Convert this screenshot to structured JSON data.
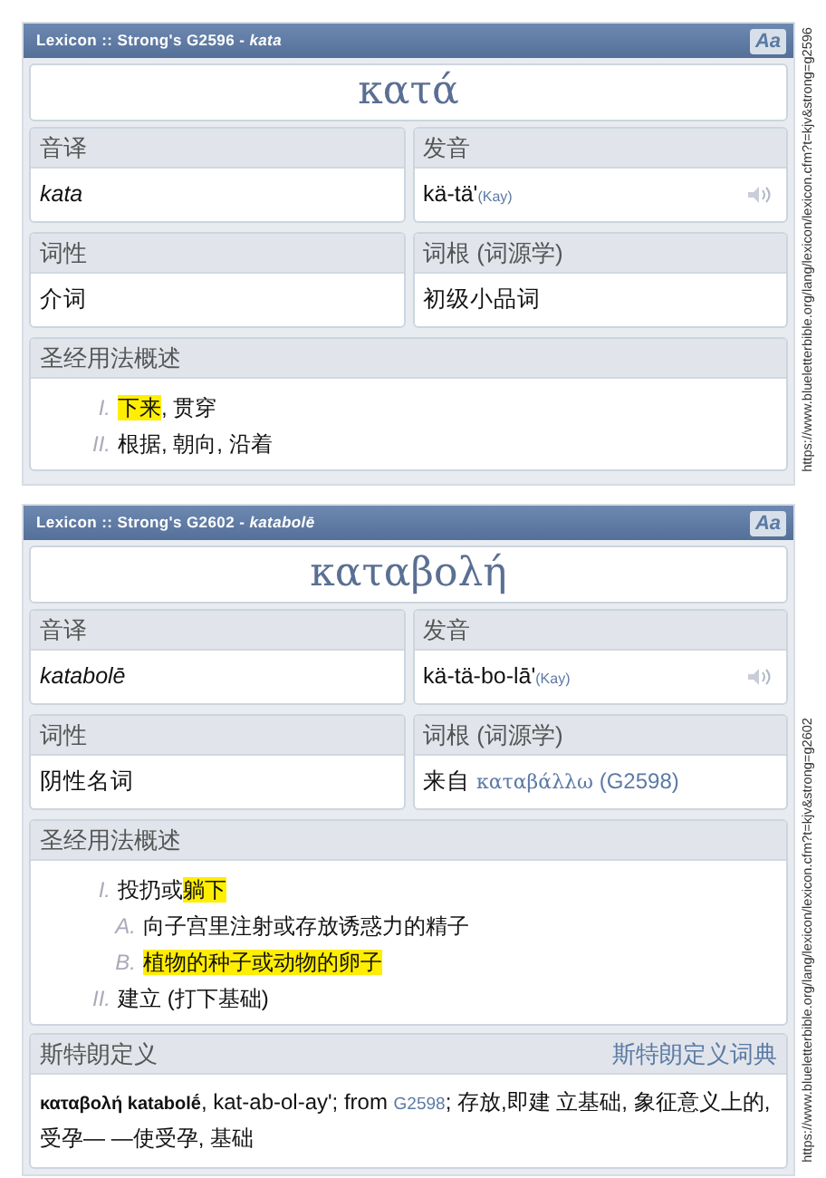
{
  "entries": [
    {
      "title": "Lexicon :: Strong's G2596 - *kata*",
      "font_button": "Aa",
      "word": "κατά",
      "url": "https://www.blueletterbible.org/lang/lexicon/lexicon.cfm?t=kjv&strong=g2596",
      "fields": [
        {
          "label": "音译",
          "kind": "italic",
          "segments": [
            {
              "kind": "text",
              "text": "kata"
            }
          ]
        },
        {
          "label": "发音",
          "kind": "audio",
          "segments": [
            {
              "kind": "text",
              "text": "kä-tä'"
            },
            {
              "kind": "note",
              "text": "(Kay)"
            }
          ]
        },
        {
          "label": "词性",
          "kind": "plain",
          "segments": [
            {
              "kind": "text",
              "text": "介词"
            }
          ]
        },
        {
          "label": "词根 (词源学)",
          "kind": "plain",
          "segments": [
            {
              "kind": "text",
              "text": "初级小品词"
            }
          ]
        }
      ],
      "usage": {
        "label": "圣经用法概述",
        "items": [
          {
            "marker": "I.",
            "segments": [
              {
                "text": "下来",
                "highlighted": true
              },
              {
                "text": ", 贯穿",
                "highlighted": false
              }
            ]
          },
          {
            "marker": "II.",
            "segments": [
              {
                "text": "根据, 朝向, 沿着",
                "highlighted": false
              }
            ]
          }
        ]
      }
    },
    {
      "title": "Lexicon :: Strong's G2602 - *katabolē*",
      "font_button": "Aa",
      "word": "καταβολή",
      "url": "https://www.blueletterbible.org/lang/lexicon/lexicon.cfm?t=kjv&strong=g2602",
      "fields": [
        {
          "label": "音译",
          "kind": "italic",
          "segments": [
            {
              "kind": "text",
              "text": "katabolē"
            }
          ]
        },
        {
          "label": "发音",
          "kind": "audio",
          "segments": [
            {
              "kind": "text",
              "text": "kä-tä-bo-lā'"
            },
            {
              "kind": "note",
              "text": "(Kay)"
            }
          ]
        },
        {
          "label": "词性",
          "kind": "plain",
          "segments": [
            {
              "kind": "text",
              "text": "阴性名词"
            }
          ]
        },
        {
          "label": "词根 (词源学)",
          "kind": "plain",
          "segments": [
            {
              "kind": "text",
              "text": "来自 "
            },
            {
              "kind": "link",
              "text": "καταβάλλω"
            },
            {
              "kind": "note",
              "text": " (G2598)"
            }
          ]
        }
      ],
      "usage": {
        "label": "圣经用法概述",
        "items": [
          {
            "marker": "I.",
            "segments": [
              {
                "text": "投扔或",
                "highlighted": false
              },
              {
                "text": "躺下",
                "highlighted": true
              }
            ],
            "children": [
              {
                "marker": "A.",
                "segments": [
                  {
                    "text": "向子宫里注射或存放诱惑力的精子",
                    "highlighted": false
                  }
                ]
              },
              {
                "marker": "B.",
                "segments": [
                  {
                    "text": "植物的种子或动物的卵子",
                    "highlighted": true
                  }
                ]
              }
            ]
          },
          {
            "marker": "II.",
            "segments": [
              {
                "text": "建立 (打下基础)",
                "highlighted": false
              }
            ]
          }
        ]
      },
      "strongs": {
        "label": "斯特朗定义",
        "link": "斯特朗定义词典",
        "segments": [
          {
            "kind": "text",
            "text": "**καταβολή katabolḗ**, kat-ab-ol-ay'; from "
          },
          {
            "kind": "link",
            "text": "G2598"
          },
          {
            "kind": "text",
            "text": "; 存放,即建 立基础, 象征意义上的, 受孕— —使受孕, 基础"
          }
        ]
      }
    }
  ]
}
